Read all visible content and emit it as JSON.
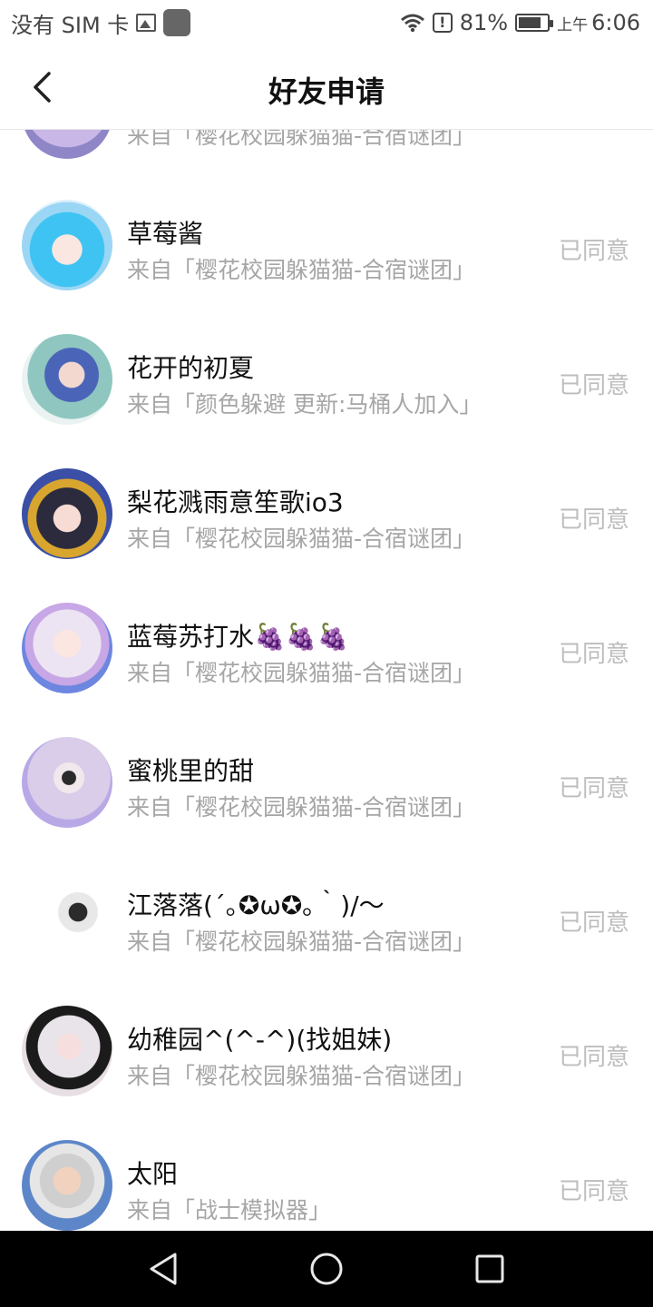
{
  "status_bar": {
    "carrier": "没有 SIM 卡",
    "battery": "81%",
    "ampm": "上午",
    "time": "6:06",
    "icons": [
      "gallery-icon",
      "app-icon",
      "wifi-icon",
      "alert-icon",
      "battery-icon"
    ]
  },
  "header": {
    "title": "好友申请",
    "back_icon": "chevron-left-icon"
  },
  "partial_row": {
    "source": "来自「樱花校园躲猫猫-合宿谜团」"
  },
  "requests": [
    {
      "name": "草莓酱",
      "source": "来自「樱花校园躲猫猫-合宿谜团」",
      "status": "已同意"
    },
    {
      "name": "花开的初夏",
      "source": "来自「颜色躲避 更新:马桶人加入」",
      "status": "已同意"
    },
    {
      "name": "梨花溅雨意笙歌io3",
      "source": "来自「樱花校园躲猫猫-合宿谜团」",
      "status": "已同意"
    },
    {
      "name": "蓝莓苏打水🍇🍇🍇",
      "source": "来自「樱花校园躲猫猫-合宿谜团」",
      "status": "已同意"
    },
    {
      "name": "蜜桃里的甜",
      "source": "来自「樱花校园躲猫猫-合宿谜团」",
      "status": "已同意"
    },
    {
      "name": "江落落(´｡✪ω✪｡｀)/～",
      "source": "来自「樱花校园躲猫猫-合宿谜团」",
      "status": "已同意"
    },
    {
      "name": "幼稚园^(^-^)(找姐妹)",
      "source": "来自「樱花校园躲猫猫-合宿谜团」",
      "status": "已同意"
    },
    {
      "name": "太阳",
      "source": "来自「战士模拟器」",
      "status": "已同意"
    }
  ],
  "colors": {
    "status_text": "#bdbdbd",
    "source_text": "#a6a6a6",
    "nav_bar": "#000000"
  },
  "nav_bar": {
    "icons": [
      "back-triangle-icon",
      "home-circle-icon",
      "recents-square-icon"
    ]
  }
}
